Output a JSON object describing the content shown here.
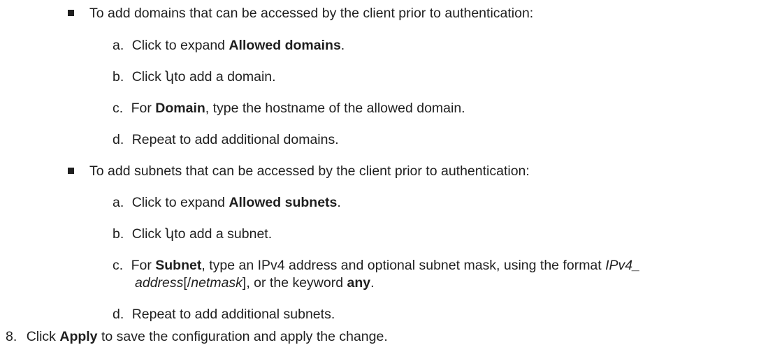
{
  "section1": {
    "intro": "To add domains that can be accessed by the client prior to authentication:",
    "steps": [
      {
        "marker": "a.",
        "pre": "Click to expand ",
        "bold": "Allowed domains",
        "post": "."
      },
      {
        "marker": "b.",
        "pre": "Click ",
        "icon": "ʮ",
        "post": "to add a domain."
      },
      {
        "marker": "c.",
        "pre": "For ",
        "bold": "Domain",
        "post": ", type the hostname of the allowed domain."
      },
      {
        "marker": "d.",
        "text": "Repeat to add additional domains."
      }
    ]
  },
  "section2": {
    "intro": "To add subnets that can be accessed by the client prior to authentication:",
    "steps": [
      {
        "marker": "a.",
        "pre": "Click to expand ",
        "bold": "Allowed subnets",
        "post": "."
      },
      {
        "marker": "b.",
        "pre": "Click ",
        "icon": "ʮ",
        "post": "to add a subnet."
      },
      {
        "marker": "c.",
        "pre": "For ",
        "bold": "Subnet",
        "mid": ", type an IPv4 address and optional subnet mask, using the format ",
        "italic1": "IPv4_",
        "italic2": "address",
        "bracket_open": "[/",
        "italic3": "netmask",
        "bracket_close": "], or the keyword ",
        "bold2": "any",
        "end": "."
      },
      {
        "marker": "d.",
        "text": "Repeat to add additional subnets."
      }
    ]
  },
  "step8": {
    "marker": "8.",
    "pre": "Click ",
    "bold": "Apply",
    "post": " to save the configuration and apply the change."
  }
}
